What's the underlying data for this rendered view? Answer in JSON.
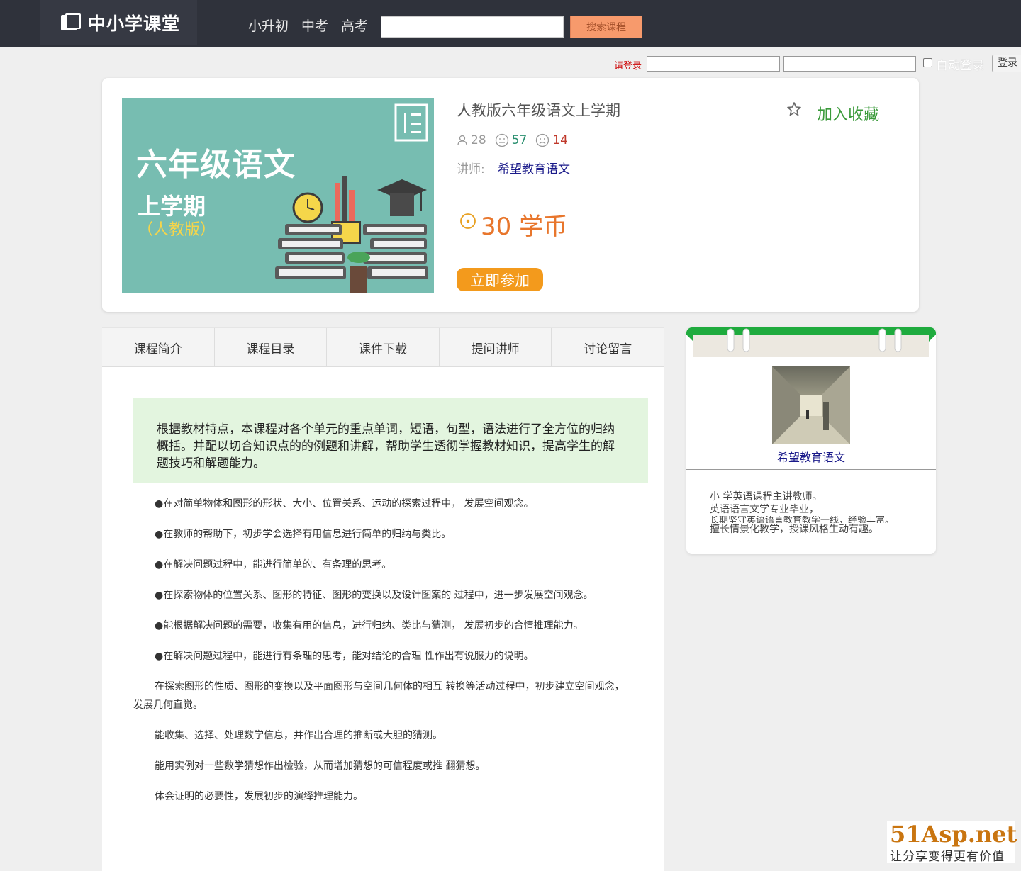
{
  "header": {
    "logo_text": "中小学课堂",
    "nav": [
      "小升初",
      "中考",
      "高考"
    ],
    "search_placeholder": "",
    "search_button": "搜索课程"
  },
  "login": {
    "tip": "请登录",
    "username_value": "",
    "password_value": "",
    "auto_login_label": "自动登录",
    "auto_login_checked": false,
    "login_button": "登录"
  },
  "course": {
    "cover": {
      "title": "六年级语文",
      "subtitle": "上学期",
      "edition": "（人教版）"
    },
    "name": "人教版六年级语文上学期",
    "favorite_label": "加入收藏",
    "stats": {
      "students": "28",
      "good": "57",
      "bad": "14"
    },
    "teacher_label": "讲师:",
    "teacher_name": "希望教育语文",
    "price": "30 学币",
    "join_button": "立即参加"
  },
  "tabs": [
    "课程简介",
    "课程目录",
    "课件下载",
    "提问讲师",
    "讨论留言"
  ],
  "intro": "根据教材特点，本课程对各个单元的重点单词，短语，句型，语法进行了全方位的归纳概括。并配以切合知识点的的例题和讲解，帮助学生透彻掌握教材知识，提高学生的解题技巧和解题能力。",
  "description": [
    "●在对简单物体和图形的形状、大小、位置关系、运动的探索过程中， 发展空间观念。",
    "●在教师的帮助下，初步学会选择有用信息进行简单的归纳与类比。",
    "●在解决问题过程中，能进行简单的、有条理的思考。",
    "●在探索物体的位置关系、图形的特征、图形的变换以及设计图案的 过程中，进一步发展空间观念。",
    "●能根据解决问题的需要，收集有用的信息，进行归纳、类比与猜测， 发展初步的合情推理能力。",
    "●在解决问题过程中，能进行有条理的思考，能对结论的合理 性作出有说服力的说明。",
    "在探索图形的性质、图形的变换以及平面图形与空间几何体的相互 转换等活动过程中，初步建立空间观念，发展几何直觉。",
    "能收集、选择、处理数学信息，并作出合理的推断或大胆的猜测。",
    "能用实例对一些数学猜想作出检验，从而增加猜想的可信程度或推 翻猜想。",
    "体会证明的必要性，发展初步的演绎推理能力。"
  ],
  "teacher_card": {
    "name": "希望教育语文",
    "bio": [
      "小 学英语课程主讲教师。",
      "英语语言文学专业毕业，",
      "长期坚守英语语言教育教学一线，经验丰富。",
      "擅长情景化教学，授课风格生动有趣。"
    ]
  },
  "watermark": {
    "logo": "51Asp.net",
    "slogan": "让分享变得更有价值"
  },
  "colors": {
    "topbar": "#2f323b",
    "accent_orange": "#f39a1c",
    "price": "#e8762c",
    "favorite": "#3a9a3a",
    "link": "#1a1a8a",
    "intro_bg": "#e3f5df"
  }
}
